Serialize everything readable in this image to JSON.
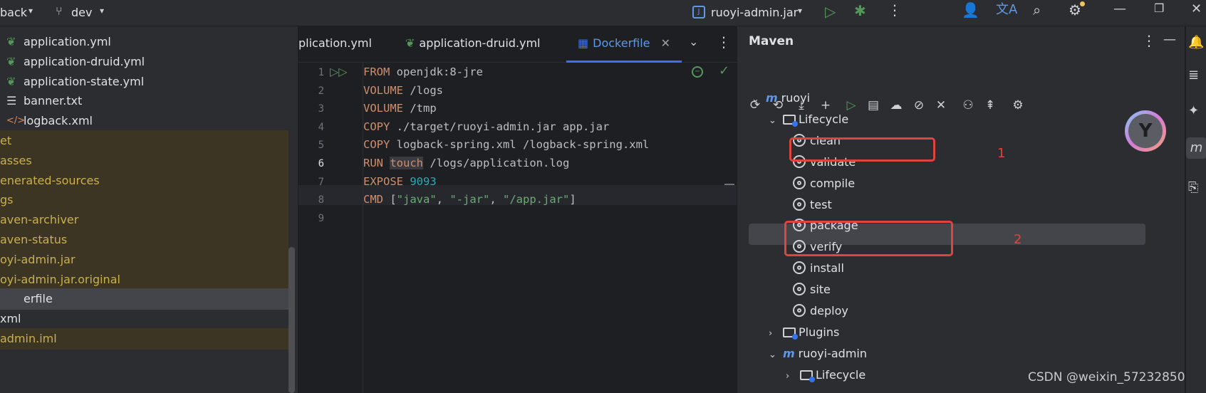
{
  "titlebar": {
    "project_name": "back",
    "branch": "dev",
    "run_config": "ruoyi-admin.jar"
  },
  "project_tree": [
    {
      "label": "application.yml",
      "icon": "yml-icon",
      "style": "normal"
    },
    {
      "label": "application-druid.yml",
      "icon": "yml-icon",
      "style": "normal"
    },
    {
      "label": "application-state.yml",
      "icon": "yml-icon",
      "style": "normal"
    },
    {
      "label": "banner.txt",
      "icon": "text-file-icon",
      "style": "normal"
    },
    {
      "label": "logback.xml",
      "icon": "xml-icon",
      "style": "normal"
    },
    {
      "label": "et",
      "style": "excluded"
    },
    {
      "label": "asses",
      "style": "excluded"
    },
    {
      "label": "enerated-sources",
      "style": "excluded"
    },
    {
      "label": "gs",
      "style": "excluded"
    },
    {
      "label": "aven-archiver",
      "style": "excluded"
    },
    {
      "label": "aven-status",
      "style": "excluded"
    },
    {
      "label": "oyi-admin.jar",
      "style": "excluded"
    },
    {
      "label": "oyi-admin.jar.original",
      "style": "excluded"
    },
    {
      "label": "erfile",
      "style": "selected"
    },
    {
      "label": "xml",
      "style": "cut"
    },
    {
      "label": "admin.iml",
      "style": "excluded"
    }
  ],
  "editor": {
    "tabs": [
      {
        "label": "plication.yml",
        "active": false
      },
      {
        "label": "application-druid.yml",
        "active": false
      },
      {
        "label": "Dockerfile",
        "active": true
      }
    ],
    "line_numbers": [
      "1",
      "2",
      "3",
      "4",
      "5",
      "6",
      "7",
      "8",
      "9"
    ],
    "lines": [
      [
        {
          "t": "FROM",
          "c": "kw"
        },
        {
          "t": " openjdk:8-jre",
          "c": ""
        }
      ],
      [
        {
          "t": "VOLUME",
          "c": "kw"
        },
        {
          "t": " /logs",
          "c": ""
        }
      ],
      [
        {
          "t": "VOLUME",
          "c": "kw"
        },
        {
          "t": " /tmp",
          "c": ""
        }
      ],
      [
        {
          "t": "COPY",
          "c": "kw"
        },
        {
          "t": " ./target/ruoyi-admin.jar app.jar",
          "c": ""
        }
      ],
      [
        {
          "t": "COPY",
          "c": "kw"
        },
        {
          "t": " logback-spring.xml /logback-spring.xml",
          "c": ""
        }
      ],
      [
        {
          "t": "RUN",
          "c": "kw"
        },
        {
          "t": " ",
          "c": ""
        },
        {
          "t": "touch",
          "c": "kw hl"
        },
        {
          "t": " /logs/application.log",
          "c": ""
        }
      ],
      [
        {
          "t": "EXPOSE",
          "c": "kw"
        },
        {
          "t": " ",
          "c": ""
        },
        {
          "t": "9093",
          "c": "num"
        }
      ],
      [
        {
          "t": "CMD",
          "c": "kw"
        },
        {
          "t": " [",
          "c": ""
        },
        {
          "t": "\"java\"",
          "c": "str"
        },
        {
          "t": ", ",
          "c": ""
        },
        {
          "t": "\"-jar\"",
          "c": "str"
        },
        {
          "t": ", ",
          "c": ""
        },
        {
          "t": "\"/app.jar\"",
          "c": "str"
        },
        {
          "t": "]",
          "c": ""
        }
      ],
      []
    ]
  },
  "maven": {
    "title": "Maven",
    "tree": [
      {
        "label": "ruoyi",
        "type": "module",
        "level": 0,
        "expanded": true
      },
      {
        "label": "Lifecycle",
        "type": "folder",
        "level": 1,
        "expanded": true
      },
      {
        "label": "clean",
        "type": "goal",
        "level": 2
      },
      {
        "label": "validate",
        "type": "goal",
        "level": 2
      },
      {
        "label": "compile",
        "type": "goal",
        "level": 2
      },
      {
        "label": "test",
        "type": "goal",
        "level": 2
      },
      {
        "label": "package",
        "type": "goal",
        "level": 2,
        "selected": true
      },
      {
        "label": "verify",
        "type": "goal",
        "level": 2
      },
      {
        "label": "install",
        "type": "goal",
        "level": 2
      },
      {
        "label": "site",
        "type": "goal",
        "level": 2
      },
      {
        "label": "deploy",
        "type": "goal",
        "level": 2
      },
      {
        "label": "Plugins",
        "type": "folder",
        "level": 1,
        "expanded": false
      },
      {
        "label": "ruoyi-admin",
        "type": "module",
        "level": 1,
        "expanded": true
      },
      {
        "label": "Lifecycle",
        "type": "folder",
        "level": 2,
        "expanded": false
      }
    ],
    "annotations": [
      "1",
      "2"
    ]
  },
  "watermark": "CSDN @weixin_57232850",
  "colors": {
    "accent": "#3574f0",
    "annotation_red": "#e0443e",
    "excluded_bg": "#3d3523",
    "excluded_text": "#c9b04c"
  }
}
